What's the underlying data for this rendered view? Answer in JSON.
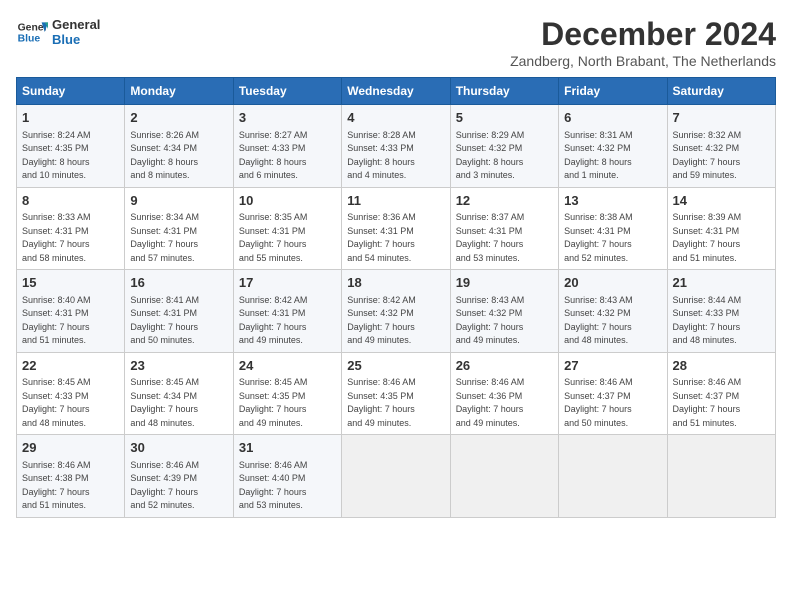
{
  "logo": {
    "line1": "General",
    "line2": "Blue"
  },
  "title": "December 2024",
  "subtitle": "Zandberg, North Brabant, The Netherlands",
  "days_of_week": [
    "Sunday",
    "Monday",
    "Tuesday",
    "Wednesday",
    "Thursday",
    "Friday",
    "Saturday"
  ],
  "weeks": [
    [
      {
        "day": 1,
        "info": "Sunrise: 8:24 AM\nSunset: 4:35 PM\nDaylight: 8 hours\nand 10 minutes."
      },
      {
        "day": 2,
        "info": "Sunrise: 8:26 AM\nSunset: 4:34 PM\nDaylight: 8 hours\nand 8 minutes."
      },
      {
        "day": 3,
        "info": "Sunrise: 8:27 AM\nSunset: 4:33 PM\nDaylight: 8 hours\nand 6 minutes."
      },
      {
        "day": 4,
        "info": "Sunrise: 8:28 AM\nSunset: 4:33 PM\nDaylight: 8 hours\nand 4 minutes."
      },
      {
        "day": 5,
        "info": "Sunrise: 8:29 AM\nSunset: 4:32 PM\nDaylight: 8 hours\nand 3 minutes."
      },
      {
        "day": 6,
        "info": "Sunrise: 8:31 AM\nSunset: 4:32 PM\nDaylight: 8 hours\nand 1 minute."
      },
      {
        "day": 7,
        "info": "Sunrise: 8:32 AM\nSunset: 4:32 PM\nDaylight: 7 hours\nand 59 minutes."
      }
    ],
    [
      {
        "day": 8,
        "info": "Sunrise: 8:33 AM\nSunset: 4:31 PM\nDaylight: 7 hours\nand 58 minutes."
      },
      {
        "day": 9,
        "info": "Sunrise: 8:34 AM\nSunset: 4:31 PM\nDaylight: 7 hours\nand 57 minutes."
      },
      {
        "day": 10,
        "info": "Sunrise: 8:35 AM\nSunset: 4:31 PM\nDaylight: 7 hours\nand 55 minutes."
      },
      {
        "day": 11,
        "info": "Sunrise: 8:36 AM\nSunset: 4:31 PM\nDaylight: 7 hours\nand 54 minutes."
      },
      {
        "day": 12,
        "info": "Sunrise: 8:37 AM\nSunset: 4:31 PM\nDaylight: 7 hours\nand 53 minutes."
      },
      {
        "day": 13,
        "info": "Sunrise: 8:38 AM\nSunset: 4:31 PM\nDaylight: 7 hours\nand 52 minutes."
      },
      {
        "day": 14,
        "info": "Sunrise: 8:39 AM\nSunset: 4:31 PM\nDaylight: 7 hours\nand 51 minutes."
      }
    ],
    [
      {
        "day": 15,
        "info": "Sunrise: 8:40 AM\nSunset: 4:31 PM\nDaylight: 7 hours\nand 51 minutes."
      },
      {
        "day": 16,
        "info": "Sunrise: 8:41 AM\nSunset: 4:31 PM\nDaylight: 7 hours\nand 50 minutes."
      },
      {
        "day": 17,
        "info": "Sunrise: 8:42 AM\nSunset: 4:31 PM\nDaylight: 7 hours\nand 49 minutes."
      },
      {
        "day": 18,
        "info": "Sunrise: 8:42 AM\nSunset: 4:32 PM\nDaylight: 7 hours\nand 49 minutes."
      },
      {
        "day": 19,
        "info": "Sunrise: 8:43 AM\nSunset: 4:32 PM\nDaylight: 7 hours\nand 49 minutes."
      },
      {
        "day": 20,
        "info": "Sunrise: 8:43 AM\nSunset: 4:32 PM\nDaylight: 7 hours\nand 48 minutes."
      },
      {
        "day": 21,
        "info": "Sunrise: 8:44 AM\nSunset: 4:33 PM\nDaylight: 7 hours\nand 48 minutes."
      }
    ],
    [
      {
        "day": 22,
        "info": "Sunrise: 8:45 AM\nSunset: 4:33 PM\nDaylight: 7 hours\nand 48 minutes."
      },
      {
        "day": 23,
        "info": "Sunrise: 8:45 AM\nSunset: 4:34 PM\nDaylight: 7 hours\nand 48 minutes."
      },
      {
        "day": 24,
        "info": "Sunrise: 8:45 AM\nSunset: 4:35 PM\nDaylight: 7 hours\nand 49 minutes."
      },
      {
        "day": 25,
        "info": "Sunrise: 8:46 AM\nSunset: 4:35 PM\nDaylight: 7 hours\nand 49 minutes."
      },
      {
        "day": 26,
        "info": "Sunrise: 8:46 AM\nSunset: 4:36 PM\nDaylight: 7 hours\nand 49 minutes."
      },
      {
        "day": 27,
        "info": "Sunrise: 8:46 AM\nSunset: 4:37 PM\nDaylight: 7 hours\nand 50 minutes."
      },
      {
        "day": 28,
        "info": "Sunrise: 8:46 AM\nSunset: 4:37 PM\nDaylight: 7 hours\nand 51 minutes."
      }
    ],
    [
      {
        "day": 29,
        "info": "Sunrise: 8:46 AM\nSunset: 4:38 PM\nDaylight: 7 hours\nand 51 minutes."
      },
      {
        "day": 30,
        "info": "Sunrise: 8:46 AM\nSunset: 4:39 PM\nDaylight: 7 hours\nand 52 minutes."
      },
      {
        "day": 31,
        "info": "Sunrise: 8:46 AM\nSunset: 4:40 PM\nDaylight: 7 hours\nand 53 minutes."
      },
      null,
      null,
      null,
      null
    ]
  ]
}
